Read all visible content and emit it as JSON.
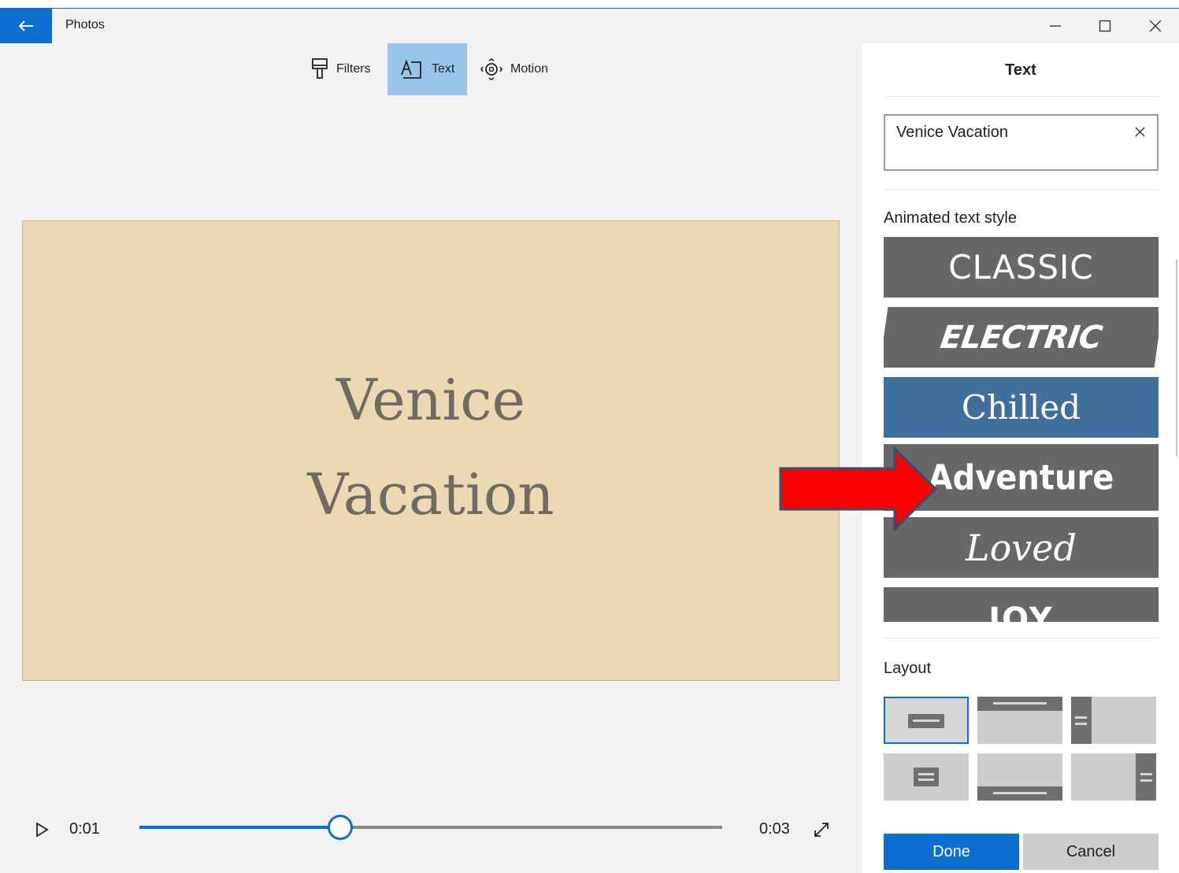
{
  "app": {
    "title": "Photos"
  },
  "toolbar": {
    "filters_label": "Filters",
    "text_label": "Text",
    "motion_label": "Motion"
  },
  "preview": {
    "line1": "Venice",
    "line2": "Vacation",
    "background_color": "#ecd8b2"
  },
  "playback": {
    "current_time": "0:01",
    "total_time": "0:03",
    "progress": 0.345
  },
  "panel": {
    "title": "Text",
    "text_value": "Venice Vacation",
    "animated_style_label": "Animated text style",
    "styles": [
      "CLASSIC",
      "ELECTRIC",
      "Chilled",
      "Adventure",
      "Loved",
      "JOY"
    ],
    "selected_style": "Chilled",
    "layout_label": "Layout",
    "done_label": "Done",
    "cancel_label": "Cancel"
  },
  "colors": {
    "accent": "#0b6fd0",
    "toolbar_active": "#99c4ea",
    "style_tile": "#676767",
    "style_selected": "#3f6f9a",
    "annotation_arrow": "#ff0000"
  },
  "icons": {
    "back": "arrow-left-icon",
    "minimize": "minimize-icon",
    "maximize": "maximize-icon",
    "close": "close-icon",
    "filters": "paintbrush-icon",
    "text": "text-box-icon",
    "motion": "motion-icon",
    "play": "play-icon",
    "fullscreen": "expand-icon",
    "clear": "clear-x-icon"
  }
}
